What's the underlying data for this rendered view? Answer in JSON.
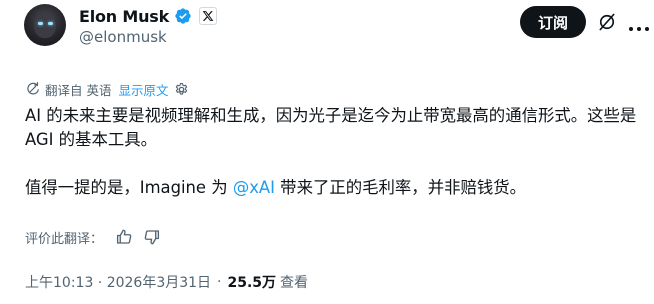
{
  "author": {
    "display_name": "Elon Musk",
    "handle": "@elonmusk",
    "avatar_icon": "avatar-dark-figure",
    "verified_color": "#1d9bf0"
  },
  "header": {
    "subscribe_label": "订阅"
  },
  "translation": {
    "label": "翻译自 英语",
    "show_original": "显示原文"
  },
  "tweet": {
    "line1": "AI 的未来主要是视频理解和生成，因为光子是迄今为止带宽最高的通信形式。这些是 AGI 的基本工具。",
    "line2_before": "值得一提的是，Imagine 为 ",
    "mention": "@xAI",
    "line2_after": " 带来了正的毛利率，并非赔钱货。"
  },
  "rating": {
    "label": "评价此翻译："
  },
  "meta": {
    "time": "上午10:13 · 2026年3月31日",
    "separator": "·",
    "views": "25.5万",
    "views_label": "查看"
  },
  "colors": {
    "text": "#0f1419",
    "muted": "#536471",
    "link": "#1d9bf0",
    "button_bg": "#0f1419"
  }
}
